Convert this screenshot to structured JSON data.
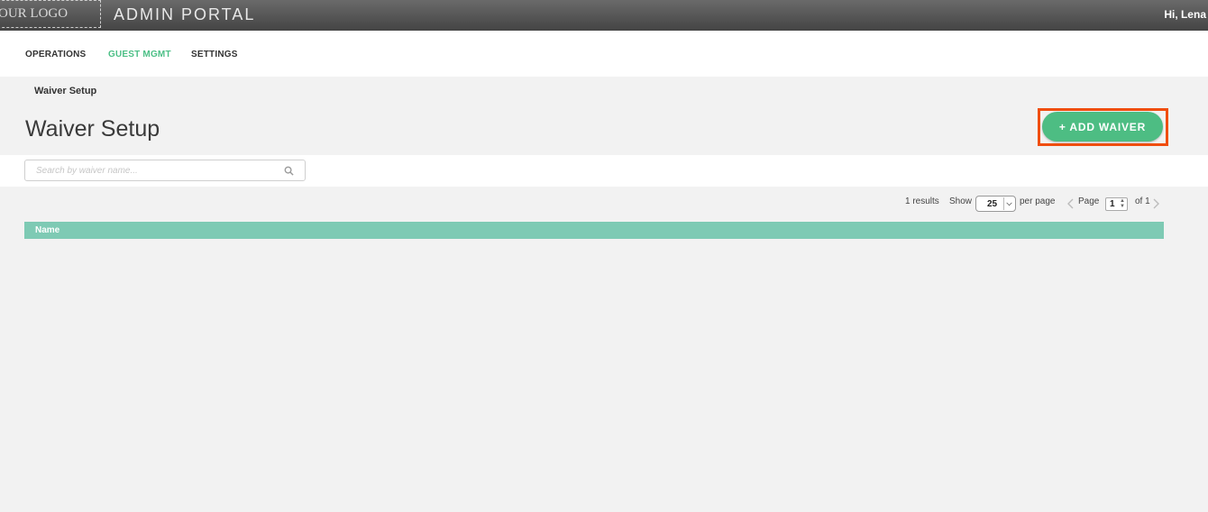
{
  "header": {
    "logo_text": "OUR LOGO",
    "portal_title": "ADMIN PORTAL",
    "greeting": "Hi, Lena"
  },
  "nav": {
    "items": [
      {
        "label": "OPERATIONS",
        "active": false
      },
      {
        "label": "GUEST MGMT",
        "active": true
      },
      {
        "label": "SETTINGS",
        "active": false
      }
    ]
  },
  "breadcrumb": "Waiver Setup",
  "page": {
    "title": "Waiver Setup",
    "add_button_label": "+ ADD WAIVER"
  },
  "search": {
    "placeholder": "Search by waiver name..."
  },
  "pagination": {
    "results": "1 results",
    "show_label": "Show",
    "per_page_value": "25",
    "per_page_label": "per page",
    "page_label": "Page",
    "current_page": "1",
    "of_label": "of 1"
  },
  "table": {
    "columns": [
      "Name"
    ],
    "rows": []
  },
  "colors": {
    "accent": "#4dbd83",
    "table_header": "#7ecab4",
    "highlight": "#f04e0f"
  }
}
